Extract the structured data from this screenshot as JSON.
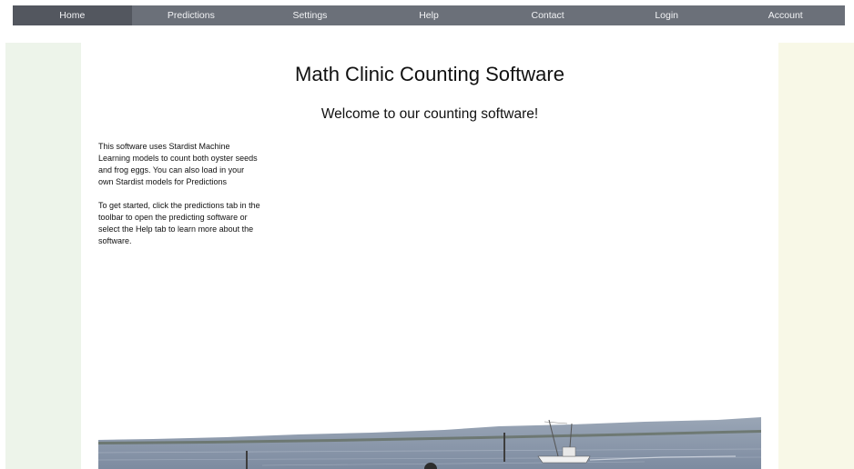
{
  "nav": {
    "items": [
      {
        "label": "Home"
      },
      {
        "label": "Predictions"
      },
      {
        "label": "Settings"
      },
      {
        "label": "Help"
      },
      {
        "label": "Contact"
      },
      {
        "label": "Login"
      },
      {
        "label": "Account"
      }
    ],
    "active": "Home",
    "bar_color": "#6b7079",
    "active_color": "#53575f"
  },
  "main": {
    "title": "Math Clinic Counting Software",
    "subtitle": "Welcome to our counting software!",
    "paragraphs": [
      "This software uses Stardist Machine Learning models to count both oyster seeds and frog eggs. You can also load in your own Stardist models for Predictions",
      "To get started, click the predictions tab in the toolbar to open the predicting software or select the Help tab to learn more about the software."
    ]
  },
  "colors": {
    "left_panel": "#edf4ea",
    "right_panel": "#f8f8e7"
  }
}
